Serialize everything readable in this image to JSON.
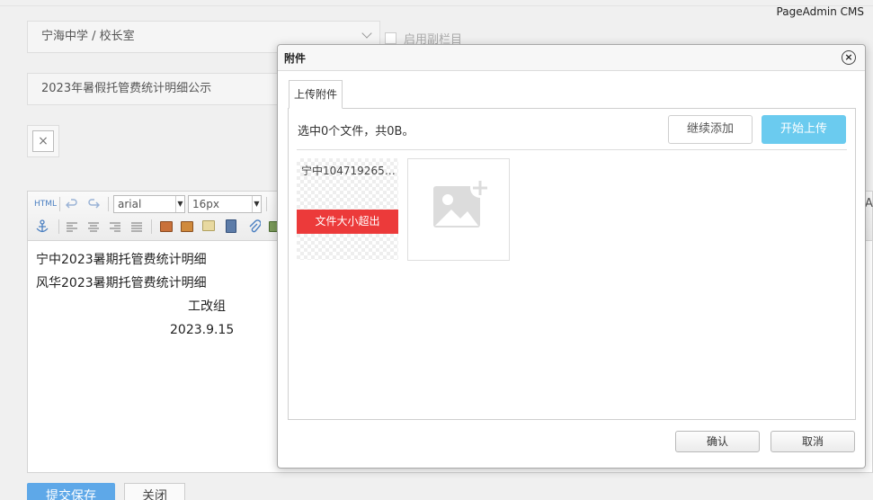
{
  "brand": "PageAdmin CMS",
  "form": {
    "category": "宁海中学 / 校长室",
    "subcolumn_label": "启用副栏目",
    "title": "2023年暑假托管费统计明细公示",
    "thumbnail_remove": "×"
  },
  "editor": {
    "html_btn": "HTML",
    "font_family": "arial",
    "font_size": "16px",
    "lines": [
      "宁中2023暑期托管费统计明细",
      "风华2023暑期托管费统计明细",
      "工改组",
      "2023.9.15"
    ],
    "edge_glyph": "A"
  },
  "footer": {
    "save": "提交保存",
    "close": "关闭"
  },
  "dialog": {
    "title": "附件",
    "close": "×",
    "tab": "上传附件",
    "status": "选中0个文件，共0B。",
    "add_more": "继续添加",
    "start_upload": "开始上传",
    "file": {
      "name": "宁中1047192656....",
      "error": "文件大小超出"
    },
    "confirm": "确认",
    "cancel": "取消"
  }
}
